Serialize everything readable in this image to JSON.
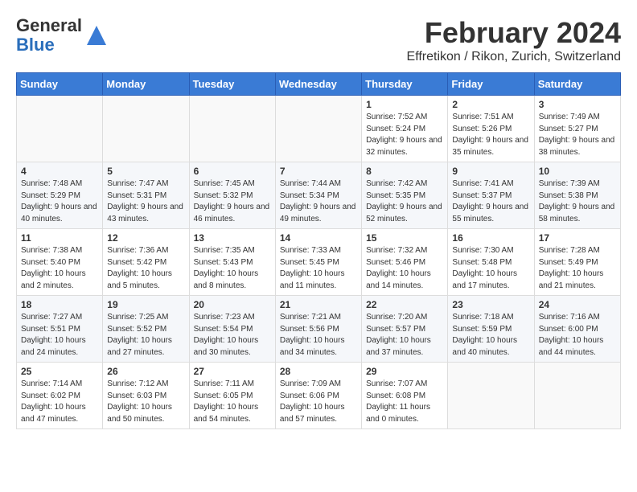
{
  "header": {
    "logo_general": "General",
    "logo_blue": "Blue",
    "title": "February 2024",
    "subtitle": "Effretikon / Rikon, Zurich, Switzerland"
  },
  "calendar": {
    "weekdays": [
      "Sunday",
      "Monday",
      "Tuesday",
      "Wednesday",
      "Thursday",
      "Friday",
      "Saturday"
    ],
    "weeks": [
      [
        {
          "day": "",
          "info": ""
        },
        {
          "day": "",
          "info": ""
        },
        {
          "day": "",
          "info": ""
        },
        {
          "day": "",
          "info": ""
        },
        {
          "day": "1",
          "info": "Sunrise: 7:52 AM\nSunset: 5:24 PM\nDaylight: 9 hours and 32 minutes."
        },
        {
          "day": "2",
          "info": "Sunrise: 7:51 AM\nSunset: 5:26 PM\nDaylight: 9 hours and 35 minutes."
        },
        {
          "day": "3",
          "info": "Sunrise: 7:49 AM\nSunset: 5:27 PM\nDaylight: 9 hours and 38 minutes."
        }
      ],
      [
        {
          "day": "4",
          "info": "Sunrise: 7:48 AM\nSunset: 5:29 PM\nDaylight: 9 hours and 40 minutes."
        },
        {
          "day": "5",
          "info": "Sunrise: 7:47 AM\nSunset: 5:31 PM\nDaylight: 9 hours and 43 minutes."
        },
        {
          "day": "6",
          "info": "Sunrise: 7:45 AM\nSunset: 5:32 PM\nDaylight: 9 hours and 46 minutes."
        },
        {
          "day": "7",
          "info": "Sunrise: 7:44 AM\nSunset: 5:34 PM\nDaylight: 9 hours and 49 minutes."
        },
        {
          "day": "8",
          "info": "Sunrise: 7:42 AM\nSunset: 5:35 PM\nDaylight: 9 hours and 52 minutes."
        },
        {
          "day": "9",
          "info": "Sunrise: 7:41 AM\nSunset: 5:37 PM\nDaylight: 9 hours and 55 minutes."
        },
        {
          "day": "10",
          "info": "Sunrise: 7:39 AM\nSunset: 5:38 PM\nDaylight: 9 hours and 58 minutes."
        }
      ],
      [
        {
          "day": "11",
          "info": "Sunrise: 7:38 AM\nSunset: 5:40 PM\nDaylight: 10 hours and 2 minutes."
        },
        {
          "day": "12",
          "info": "Sunrise: 7:36 AM\nSunset: 5:42 PM\nDaylight: 10 hours and 5 minutes."
        },
        {
          "day": "13",
          "info": "Sunrise: 7:35 AM\nSunset: 5:43 PM\nDaylight: 10 hours and 8 minutes."
        },
        {
          "day": "14",
          "info": "Sunrise: 7:33 AM\nSunset: 5:45 PM\nDaylight: 10 hours and 11 minutes."
        },
        {
          "day": "15",
          "info": "Sunrise: 7:32 AM\nSunset: 5:46 PM\nDaylight: 10 hours and 14 minutes."
        },
        {
          "day": "16",
          "info": "Sunrise: 7:30 AM\nSunset: 5:48 PM\nDaylight: 10 hours and 17 minutes."
        },
        {
          "day": "17",
          "info": "Sunrise: 7:28 AM\nSunset: 5:49 PM\nDaylight: 10 hours and 21 minutes."
        }
      ],
      [
        {
          "day": "18",
          "info": "Sunrise: 7:27 AM\nSunset: 5:51 PM\nDaylight: 10 hours and 24 minutes."
        },
        {
          "day": "19",
          "info": "Sunrise: 7:25 AM\nSunset: 5:52 PM\nDaylight: 10 hours and 27 minutes."
        },
        {
          "day": "20",
          "info": "Sunrise: 7:23 AM\nSunset: 5:54 PM\nDaylight: 10 hours and 30 minutes."
        },
        {
          "day": "21",
          "info": "Sunrise: 7:21 AM\nSunset: 5:56 PM\nDaylight: 10 hours and 34 minutes."
        },
        {
          "day": "22",
          "info": "Sunrise: 7:20 AM\nSunset: 5:57 PM\nDaylight: 10 hours and 37 minutes."
        },
        {
          "day": "23",
          "info": "Sunrise: 7:18 AM\nSunset: 5:59 PM\nDaylight: 10 hours and 40 minutes."
        },
        {
          "day": "24",
          "info": "Sunrise: 7:16 AM\nSunset: 6:00 PM\nDaylight: 10 hours and 44 minutes."
        }
      ],
      [
        {
          "day": "25",
          "info": "Sunrise: 7:14 AM\nSunset: 6:02 PM\nDaylight: 10 hours and 47 minutes."
        },
        {
          "day": "26",
          "info": "Sunrise: 7:12 AM\nSunset: 6:03 PM\nDaylight: 10 hours and 50 minutes."
        },
        {
          "day": "27",
          "info": "Sunrise: 7:11 AM\nSunset: 6:05 PM\nDaylight: 10 hours and 54 minutes."
        },
        {
          "day": "28",
          "info": "Sunrise: 7:09 AM\nSunset: 6:06 PM\nDaylight: 10 hours and 57 minutes."
        },
        {
          "day": "29",
          "info": "Sunrise: 7:07 AM\nSunset: 6:08 PM\nDaylight: 11 hours and 0 minutes."
        },
        {
          "day": "",
          "info": ""
        },
        {
          "day": "",
          "info": ""
        }
      ]
    ]
  }
}
